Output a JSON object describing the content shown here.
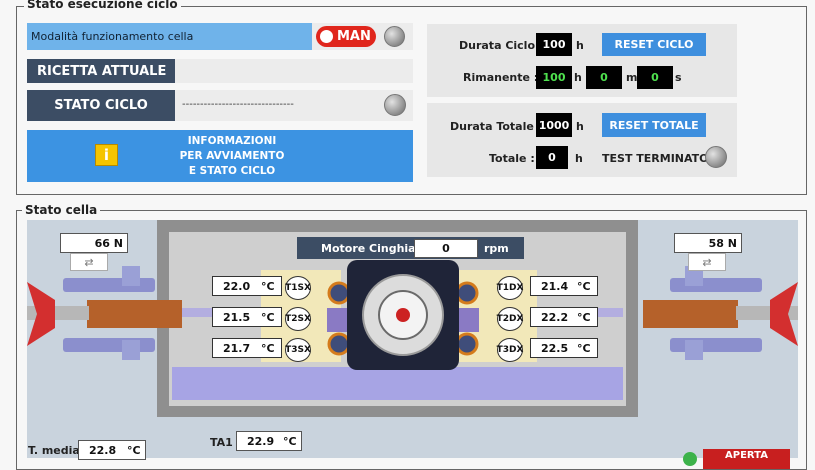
{
  "exec": {
    "title": "Stato esecuzione ciclo",
    "mode_label": "Modalità funzionamento cella",
    "mode_badge": "MAN",
    "recipe_label": "RICETTA ATTUALE",
    "recipe_value": "",
    "state_label": "STATO CICLO",
    "state_value": "-------------------------------",
    "info_lines": [
      "INFORMAZIONI",
      "PER AVVIAMENTO",
      "E STATO CICLO"
    ],
    "info_icon": "i"
  },
  "cycle": {
    "duration_label": "Durata Ciclo :",
    "duration_value": "100",
    "duration_unit": "h",
    "reset_label": "RESET CICLO",
    "remaining_label": "Rimanente :",
    "remaining_h": "100",
    "remaining_m": "0",
    "remaining_s": "0",
    "unit_h": "h",
    "unit_m": "m",
    "unit_s": "s"
  },
  "total": {
    "duration_label": "Durata Totale :",
    "duration_value": "1000",
    "duration_unit": "h",
    "reset_label": "RESET TOTALE",
    "total_label": "Totale :",
    "total_value": "0",
    "total_unit": "h",
    "test_label": "TEST TERMINATO"
  },
  "cell": {
    "title": "Stato cella",
    "force_left": "66 N",
    "force_right": "58 N",
    "motor_label": "Motore Cinghia",
    "motor_value": "0",
    "motor_unit": "rpm",
    "temp_unit": "°C",
    "temps_left": [
      {
        "value": "22.0",
        "tag": "T1SX"
      },
      {
        "value": "21.5",
        "tag": "T2SX"
      },
      {
        "value": "21.7",
        "tag": "T3SX"
      }
    ],
    "temps_right": [
      {
        "value": "21.4",
        "tag": "T1DX"
      },
      {
        "value": "22.2",
        "tag": "T2DX"
      },
      {
        "value": "22.5",
        "tag": "T3DX"
      }
    ]
  },
  "bottom": {
    "tmedia_label": "T. media",
    "tmedia_value": "22.8",
    "tmedia_unit": "°C",
    "ta1_label": "TA1",
    "ta1_value": "22.9",
    "ta1_unit": "°C",
    "door_state": "APERTA"
  },
  "colors": {
    "accent_blue": "#3e8fde",
    "mode_red": "#e0261c",
    "alarm_red": "#c81f1f",
    "value_green": "#4fe24f"
  }
}
